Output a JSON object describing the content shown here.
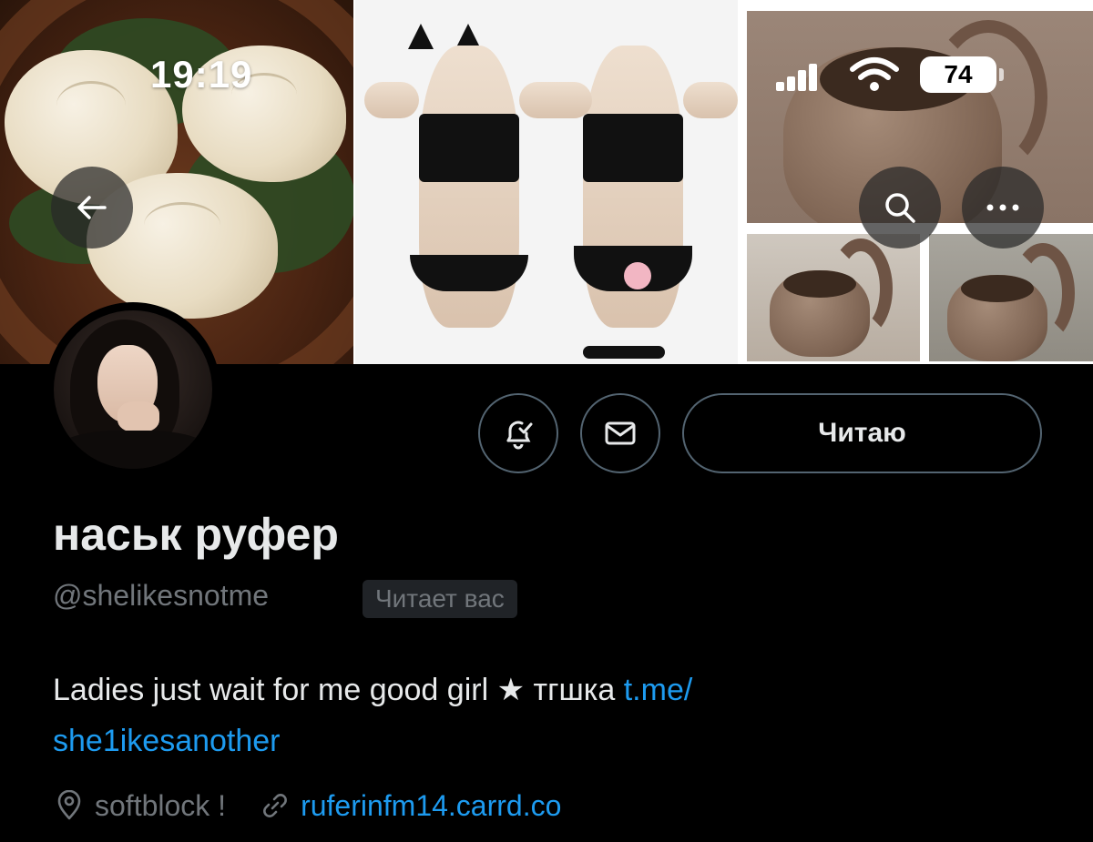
{
  "status_bar": {
    "time": "19:19",
    "battery": "74"
  },
  "header": {
    "back_icon": "arrow-left-icon",
    "search_icon": "search-icon",
    "more_icon": "more-horizontal-icon"
  },
  "profile": {
    "display_name": "наськ руфер",
    "handle": "@shelikesnotme",
    "follows_you": "Читает вас",
    "bio_text": "Ladies just wait for me good girl ★ тгшка ",
    "bio_link_1": "t.me/",
    "bio_link_2": "she1ikesanother",
    "location": "softblock !",
    "website": "ruferinfm14.carrd.co"
  },
  "actions": {
    "follow_label": "Читаю",
    "notify_icon": "bell-check-icon",
    "message_icon": "envelope-icon"
  },
  "colors": {
    "link": "#1d9bf0",
    "muted": "#71767b",
    "text": "#e7e9ea",
    "background": "#000000"
  }
}
